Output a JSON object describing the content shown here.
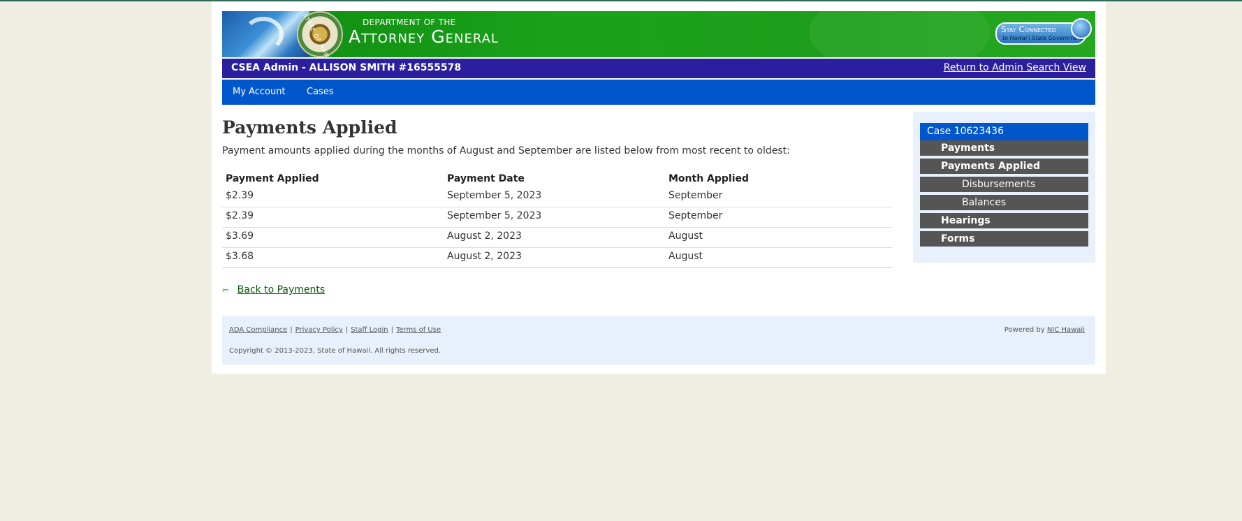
{
  "header": {
    "seal_text": "STATE OF HAWAII",
    "dept_small": "DEPARTMENT OF THE",
    "dept_big": "Attorney General",
    "stay_connected": "Stay Connected",
    "stay_sub": "to Hawai'i State Government"
  },
  "userbar": {
    "who": "CSEA Admin - ALLISON SMITH #16555578",
    "return_link": "Return to Admin Search View"
  },
  "nav": {
    "items": [
      "My Account",
      "Cases"
    ]
  },
  "main": {
    "title": "Payments Applied",
    "intro": "Payment amounts applied during the months of August and September are listed below from most recent to oldest:",
    "columns": [
      "Payment Applied",
      "Payment Date",
      "Month Applied"
    ],
    "rows": [
      [
        "$2.39",
        "September 5, 2023",
        "September"
      ],
      [
        "$2.39",
        "September 5, 2023",
        "September"
      ],
      [
        "$3.69",
        "August 2, 2023",
        "August"
      ],
      [
        "$3.68",
        "August 2, 2023",
        "August"
      ]
    ],
    "back_link": "Back to Payments"
  },
  "sidebar": {
    "header": "Case 10623436",
    "items": [
      "Payments",
      "Payments Applied",
      "Disbursements",
      "Balances",
      "Hearings",
      "Forms"
    ]
  },
  "footer": {
    "links": [
      "ADA Compliance",
      "Privacy Policy",
      "Staff Login",
      "Terms of Use"
    ],
    "separator": "|",
    "copyright": "Copyright © 2013-2023, State of Hawaii. All rights reserved.",
    "powered_prefix": "Powered by",
    "powered_link": "NIC Hawaii"
  },
  "colors": {
    "banner_green": "#1aa31a",
    "user_bar": "#2b1fa0",
    "nav_blue": "#0057cc",
    "sidebar_item": "#555555",
    "page_bg": "#f0eee2"
  }
}
